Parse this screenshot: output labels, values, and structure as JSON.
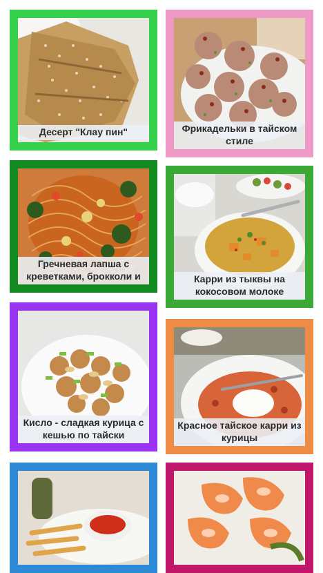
{
  "recipes": [
    {
      "title": "Десерт \"Клау пин\"",
      "border": "#35d14a"
    },
    {
      "title": "Фрикадельки в тайском стиле",
      "border": "#ef99c7"
    },
    {
      "title": "Гречневая лапша с креветками, брокколи и",
      "border": "#118a22"
    },
    {
      "title": "Карри из тыквы на кокосовом молоке",
      "border": "#3aa935"
    },
    {
      "title": "Кисло - сладкая курица с кешью по тайски",
      "border": "#9b34f2"
    },
    {
      "title": "Красное тайское карри из курицы",
      "border": "#ee8c46"
    },
    {
      "title": "",
      "border": "#2d8ad6"
    },
    {
      "title": "",
      "border": "#c0176a"
    }
  ]
}
